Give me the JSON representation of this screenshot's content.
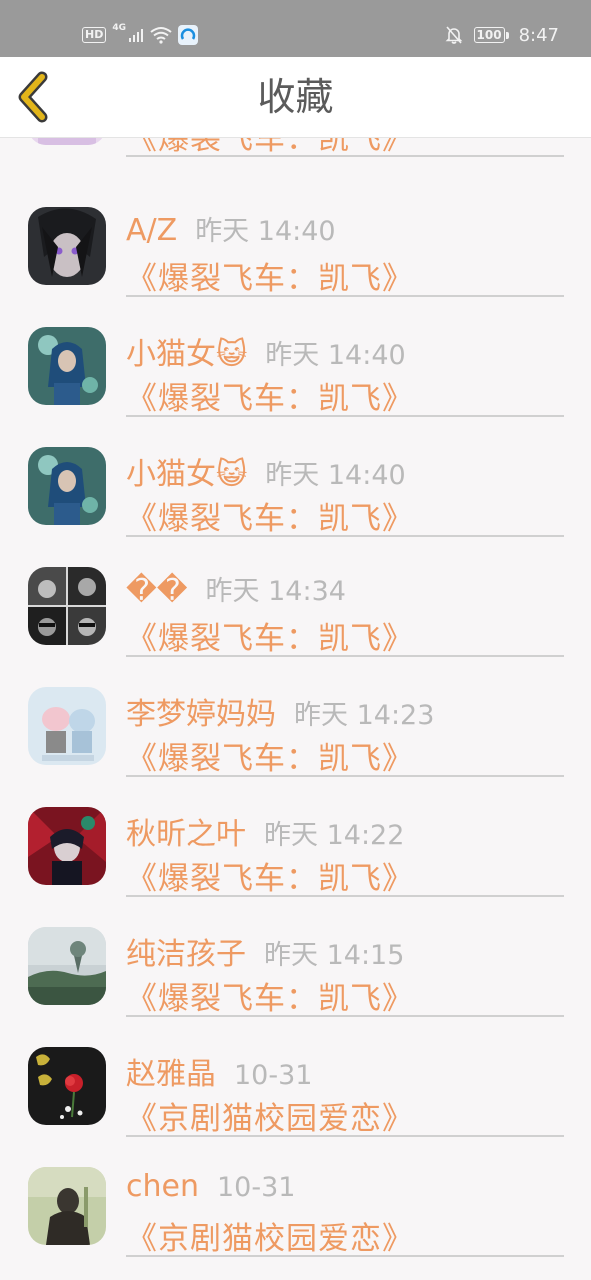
{
  "status_bar": {
    "hd": "HD",
    "network": "4G",
    "battery": "100",
    "time": "8:47"
  },
  "header": {
    "title": "收藏",
    "back_icon": "chevron-left-icon"
  },
  "colors": {
    "accent": "#ee9a62",
    "timestamp": "#b9b9b9",
    "back_arrow": "#e2b51a"
  },
  "items": [
    {
      "name": "",
      "time": "",
      "work": "《爆裂飞车：凯飞》"
    },
    {
      "name": "A/Z",
      "time": "昨天 14:40",
      "work": "《爆裂飞车：凯飞》"
    },
    {
      "name": "小猫女😺",
      "time": "昨天 14:40",
      "work": "《爆裂飞车：凯飞》"
    },
    {
      "name": "小猫女😺",
      "time": "昨天 14:40",
      "work": "《爆裂飞车：凯飞》"
    },
    {
      "name": "��",
      "time": "昨天 14:34",
      "work": "《爆裂飞车：凯飞》"
    },
    {
      "name": "李梦婷妈妈",
      "time": "昨天 14:23",
      "work": "《爆裂飞车：凯飞》"
    },
    {
      "name": "秋昕之叶",
      "time": "昨天 14:22",
      "work": "《爆裂飞车：凯飞》"
    },
    {
      "name": "纯洁孩子",
      "time": "昨天 14:15",
      "work": "《爆裂飞车：凯飞》"
    },
    {
      "name": "赵雅晶",
      "time": "10-31",
      "work": "《京剧猫校园爱恋》"
    },
    {
      "name": "chen",
      "time": "10-31",
      "work": "《京剧猫校园爱恋》"
    }
  ]
}
